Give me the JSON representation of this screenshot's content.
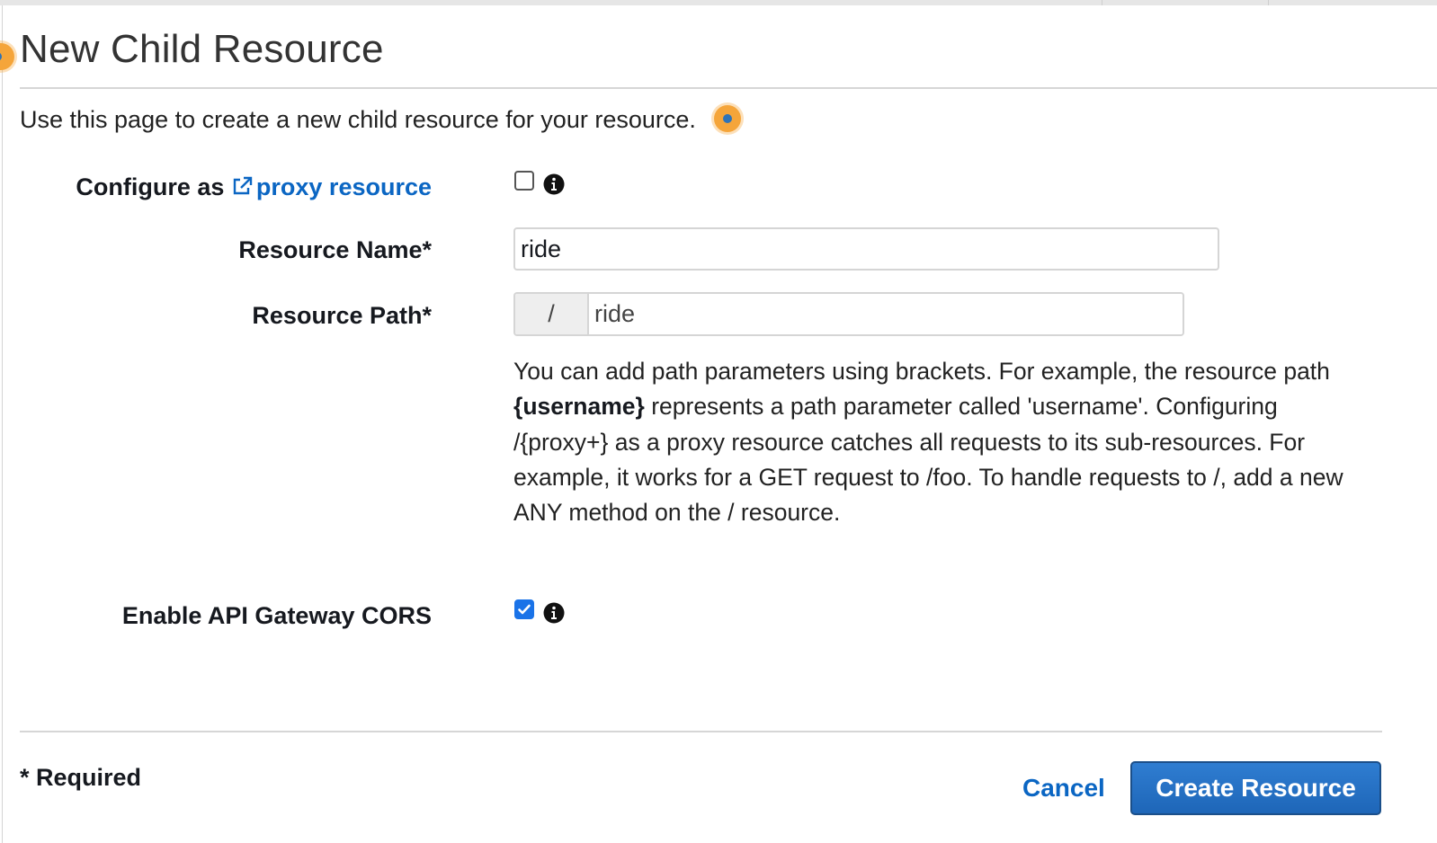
{
  "header": {
    "title": "New Child Resource",
    "intro": "Use this page to create a new child resource for your resource."
  },
  "form": {
    "proxy": {
      "label_prefix": "Configure as ",
      "link_text": "proxy resource",
      "link_icon": "external-link-icon",
      "checked": false,
      "info_icon": "info-icon"
    },
    "resource_name": {
      "label": "Resource Name*",
      "value": "ride"
    },
    "resource_path": {
      "label": "Resource Path*",
      "prefix": "/",
      "value": "ride"
    },
    "help": {
      "line1": "You can add path parameters using brackets. For example, the resource path ",
      "param": "{username}",
      "line2": " represents a path parameter called 'username'. Configuring /{proxy+} as a proxy resource catches all requests to its sub-resources. For example, it works for a GET request to /foo. To handle requests to /, add a new ANY method on the / resource."
    },
    "cors": {
      "label": "Enable API Gateway CORS",
      "checked": true,
      "info_icon": "info-icon"
    }
  },
  "footer": {
    "required_note": "* Required",
    "cancel_label": "Cancel",
    "create_label": "Create Resource"
  },
  "colors": {
    "link": "#0b66c3",
    "primary_button": "#1e66b8",
    "checkbox_checked": "#1a73e8",
    "hotspot": "#f5a53a"
  }
}
